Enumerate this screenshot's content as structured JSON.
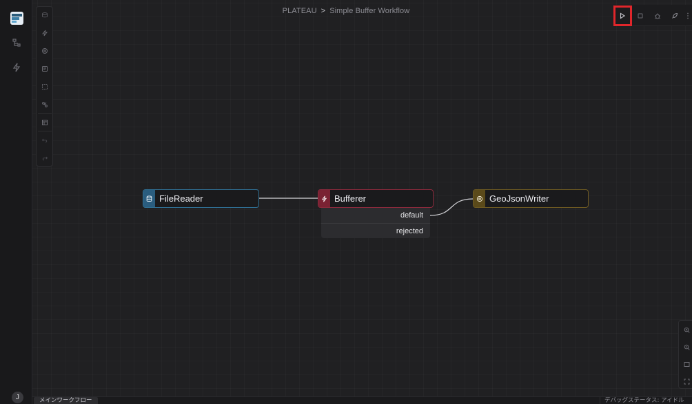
{
  "breadcrumb": {
    "project": "PLATEAU",
    "separator": ">",
    "workflow": "Simple Buffer Workflow"
  },
  "user": {
    "initial": "J"
  },
  "nodes": {
    "file_reader": {
      "label": "FileReader",
      "accent": "#2a5d7f",
      "border": "#2f6f93",
      "icon": "database-icon"
    },
    "bufferer": {
      "label": "Bufferer",
      "accent": "#7a2233",
      "border": "#8b2a3c",
      "icon": "lightning-icon"
    },
    "geojson_writer": {
      "label": "GeoJsonWriter",
      "accent": "#5b4a1a",
      "border": "#6e5a22",
      "icon": "disc-icon"
    }
  },
  "bufferer_ports": [
    "default",
    "rejected"
  ],
  "bottom": {
    "tab_label": "メインワークフロー",
    "debug_status": "デバッグステータス: アイドル"
  },
  "colors": {
    "highlight": "#e0262b",
    "canvas": "#202022"
  }
}
